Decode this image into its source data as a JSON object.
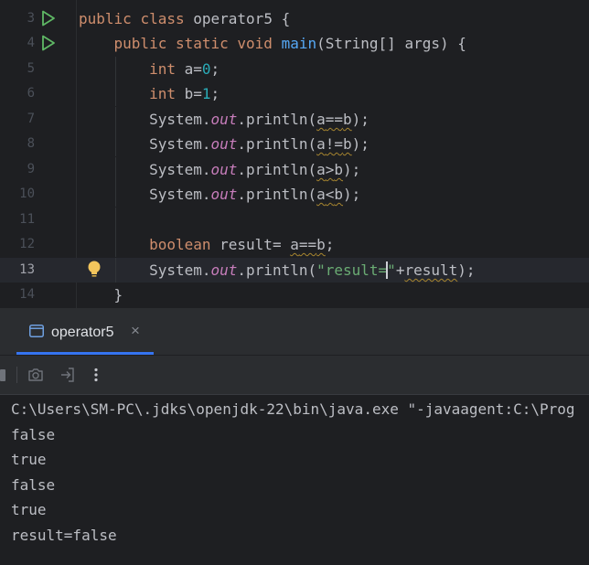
{
  "editor": {
    "lines": [
      {
        "n": "3"
      },
      {
        "n": "4"
      },
      {
        "n": "5"
      },
      {
        "n": "6"
      },
      {
        "n": "7"
      },
      {
        "n": "8"
      },
      {
        "n": "9"
      },
      {
        "n": "10"
      },
      {
        "n": "11"
      },
      {
        "n": "12"
      },
      {
        "n": "13"
      },
      {
        "n": "14"
      }
    ],
    "tokens": {
      "public": "public",
      "class": "class",
      "class_name": "operator5",
      "open_brace": "{",
      "static": "static",
      "void": "void",
      "main": "main",
      "main_params": "(String[] args) {",
      "int": "int",
      "a_decl": "a=",
      "zero": "0",
      "semi": ";",
      "b_decl": "b=",
      "one": "1",
      "system": "System.",
      "out": "out",
      "println_open": ".println(",
      "a": "a",
      "b": "b",
      "eq": "==",
      "neq": "!=",
      "gt": ">",
      "lt": "<",
      "close_semi": ");",
      "boolean": "boolean",
      "result_decl": "result= ",
      "str_open": "\"result=",
      "str_close": "\"",
      "plus_result": "+",
      "result": "result",
      "close_brace": "}"
    }
  },
  "console_tab": {
    "label": "operator5",
    "icon": "console-window-icon",
    "close": "×"
  },
  "toolbar": {
    "icons": [
      "stop-icon",
      "camera-icon",
      "exit-icon",
      "more-vertical-icon"
    ]
  },
  "console_output": [
    "C:\\Users\\SM-PC\\.jdks\\openjdk-22\\bin\\java.exe \"-javaagent:C:\\Prog",
    "false",
    "true",
    "false",
    "true",
    "result=false"
  ],
  "colors": {
    "background": "#1e1f22",
    "panel": "#2b2d30",
    "keyword": "#cf8e6d",
    "method": "#56a8f5",
    "number": "#2aacb8",
    "field": "#c77dbb",
    "string": "#6aab73",
    "run_icon": "#5fb865",
    "accent": "#3574f0"
  }
}
